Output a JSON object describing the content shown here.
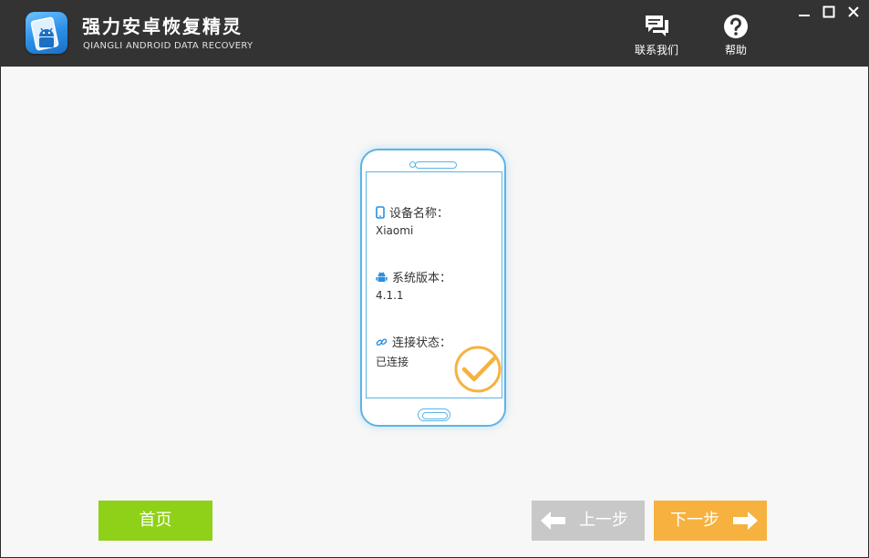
{
  "app": {
    "title": "强力安卓恢复精灵",
    "subtitle": "QIANGLI ANDROID DATA RECOVERY",
    "logo_icon": "android-phone-logo-icon"
  },
  "header_actions": {
    "contact": {
      "label": "联系我们",
      "icon": "chat-bubbles-icon"
    },
    "help": {
      "label": "帮助",
      "icon": "question-mark-icon"
    }
  },
  "window_controls": [
    "minimize-icon",
    "maximize-icon",
    "close-icon"
  ],
  "device": {
    "name_label": "设备名称：",
    "name_value": "Xiaomi",
    "version_label": "系统版本：",
    "version_value": "4.1.1",
    "status_label": "连接状态：",
    "status_value": "已连接",
    "connected_icon": "check-circle-icon"
  },
  "nav": {
    "home_label": "首页",
    "prev_label": "上一步",
    "next_label": "下一步"
  },
  "colors": {
    "titlebar": "#333333",
    "accent_blue": "#5bb4e6",
    "home_green": "#8fd018",
    "prev_gray": "#c8c8c8",
    "next_orange": "#f7b13e",
    "check_orange": "#f5b240"
  }
}
